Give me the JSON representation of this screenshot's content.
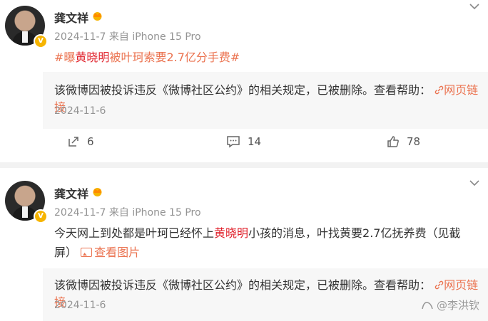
{
  "posts": [
    {
      "author": "龚文祥",
      "meta": "2024-11-7 来自 iPhone 15 Pro",
      "content": {
        "topic_prefix": "#曝",
        "topic_highlight": "黄晓明",
        "topic_suffix": "被叶珂索要2.7亿分手费#"
      },
      "repost": {
        "notice": "该微博因被投诉违反《微博社区公约》的相关规定，已被删除。查看帮助：",
        "link": "网页链接",
        "date": "2024-11-6"
      },
      "actions": {
        "reposts": "6",
        "comments": "14",
        "likes": "78"
      }
    },
    {
      "author": "龚文祥",
      "meta": "2024-11-7 来自 iPhone 15 Pro",
      "content": {
        "text_before": "今天网上到处都是叶珂已经怀上",
        "highlight": "黄晓明",
        "text_after": "小孩的消息，叶找黄要2.7亿抚养费（见截屏）",
        "view_images": "查看图片"
      },
      "repost": {
        "notice": "该微博因被投诉违反《微博社区公约》的相关规定，已被删除。查看帮助：",
        "link": "网页链接",
        "date": "2024-11-6"
      }
    }
  ],
  "watermark": "@李洪钦",
  "colors": {
    "accent": "#eb7350",
    "highlight": "#e0212b",
    "meta": "#939393",
    "repost_bg": "#f7f7f7"
  }
}
